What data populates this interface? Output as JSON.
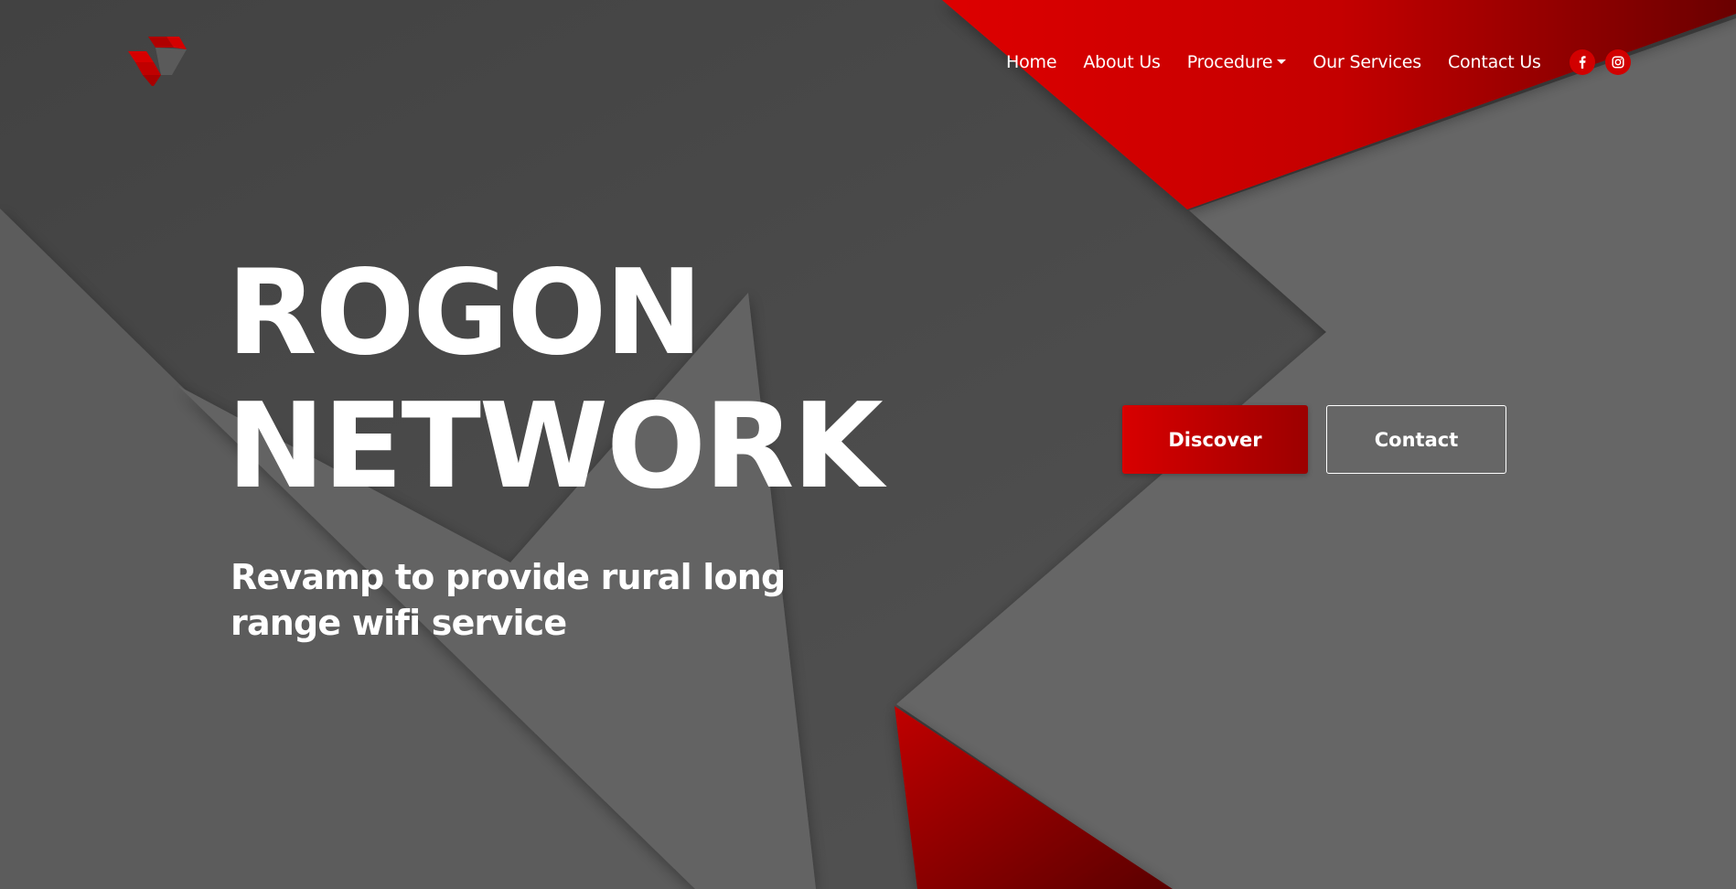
{
  "brand": {
    "logo_icon": "rogon-logo-icon",
    "accent_color": "#d10000"
  },
  "nav": {
    "items": [
      {
        "label": "Home"
      },
      {
        "label": "About Us"
      },
      {
        "label": "Procedure",
        "has_dropdown": true
      },
      {
        "label": "Our Services"
      },
      {
        "label": "Contact Us"
      }
    ],
    "social": [
      {
        "icon": "facebook-icon",
        "glyph": "f"
      },
      {
        "icon": "instagram-icon"
      }
    ]
  },
  "hero": {
    "title_line1": "ROGON",
    "title_line2": "NETWORK",
    "subtitle": "Revamp to provide rural long range wifi service"
  },
  "actions": {
    "discover_label": "Discover",
    "contact_label": "Contact"
  },
  "colors": {
    "background_dark": "#454545",
    "background_light": "#686868",
    "red_bright": "#d80000",
    "red_dark": "#6e0000"
  }
}
